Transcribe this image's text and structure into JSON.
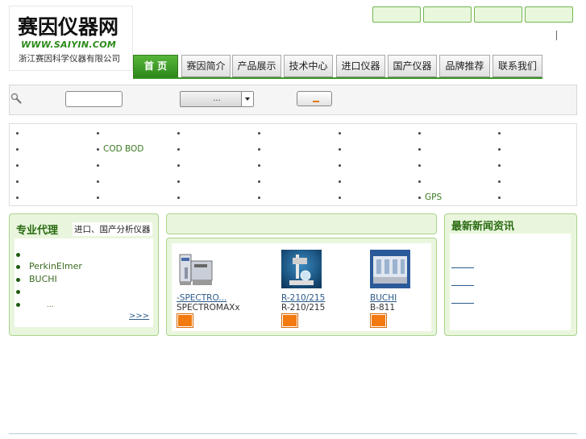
{
  "logo": {
    "name_cn": "赛因仪器网",
    "url_text": "WWW.SAIYIN.COM",
    "company": "浙江赛因科学仪器有限公司"
  },
  "top_buttons": [
    "",
    "",
    "",
    ""
  ],
  "nav": [
    {
      "label": "首 页",
      "active": true
    },
    {
      "label": "赛因简介",
      "active": false
    },
    {
      "label": "产品展示",
      "active": false
    },
    {
      "label": "技术中心",
      "active": false
    },
    {
      "label": "进口仪器",
      "active": false
    },
    {
      "label": "国产仪器",
      "active": false
    },
    {
      "label": "品牌推荐",
      "active": false
    },
    {
      "label": "联系我们",
      "active": false
    }
  ],
  "search": {
    "input_value": "",
    "select_value": "...",
    "button_label": ""
  },
  "categories": {
    "row2_col2": "COD BOD",
    "row4_col6": "GPS"
  },
  "agent_panel": {
    "title": "专业代理",
    "subtitle": "进口、国产分析仪器",
    "items": [
      "",
      "PerkinElmer",
      "BUCHI",
      "",
      "..."
    ],
    "more": ">>>"
  },
  "products": [
    {
      "name": "-SPECTRO...",
      "model": "SPECTROMAXx",
      "icon": "spectrometer-icon"
    },
    {
      "name": "R-210/215",
      "model": "R-210/215",
      "icon": "rotary-evaporator-icon"
    },
    {
      "name": "BUCHI",
      "model": "B-811",
      "icon": "extraction-unit-icon"
    }
  ],
  "news_panel": {
    "title": "最新新闻资讯",
    "items": [
      "",
      "",
      ""
    ]
  },
  "colors": {
    "accent_green": "#2f8a1c",
    "panel_bg": "#e9f6dd",
    "badge_orange": "#f27a10"
  }
}
